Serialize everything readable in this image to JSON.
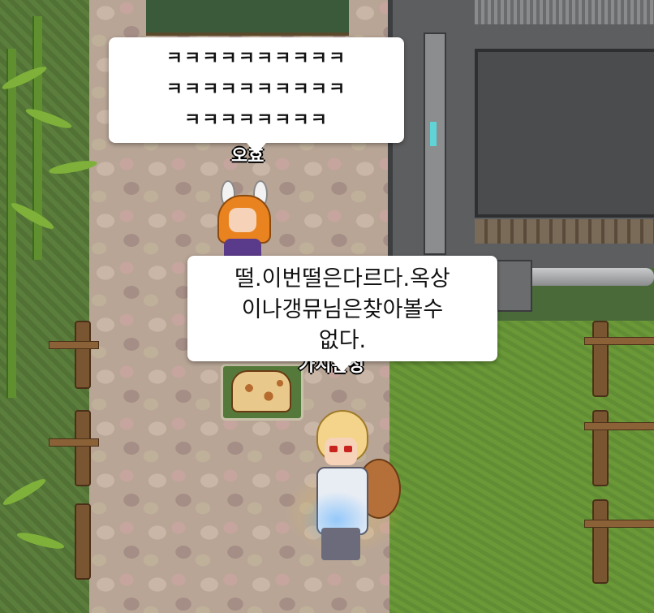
{
  "chat": {
    "bubble_top": {
      "speaker_name": "오효",
      "lines": [
        "ㅋㅋㅋㅋㅋㅋㅋㅋㅋㅋ",
        "ㅋㅋㅋㅋㅋㅋㅋㅋㅋㅋ",
        "ㅋㅋㅋㅋㅋㅋㅋㅋ"
      ]
    },
    "bubble_bottom": {
      "speaker_name": "가시관정",
      "lines": [
        "떨.이번떨은다르다.옥상",
        "이나갱뮤님은찾아볼수",
        "없다."
      ]
    }
  },
  "colors": {
    "path": "#b8a596",
    "grass": "#6a9a3a",
    "building": "#5d5e60",
    "bubble": "#ffffff",
    "name_text": "#ffffff"
  },
  "icons": {
    "player": "player-character-icon",
    "npc": "orange-hood-character-icon",
    "pet": "giraffe-pet-icon"
  }
}
